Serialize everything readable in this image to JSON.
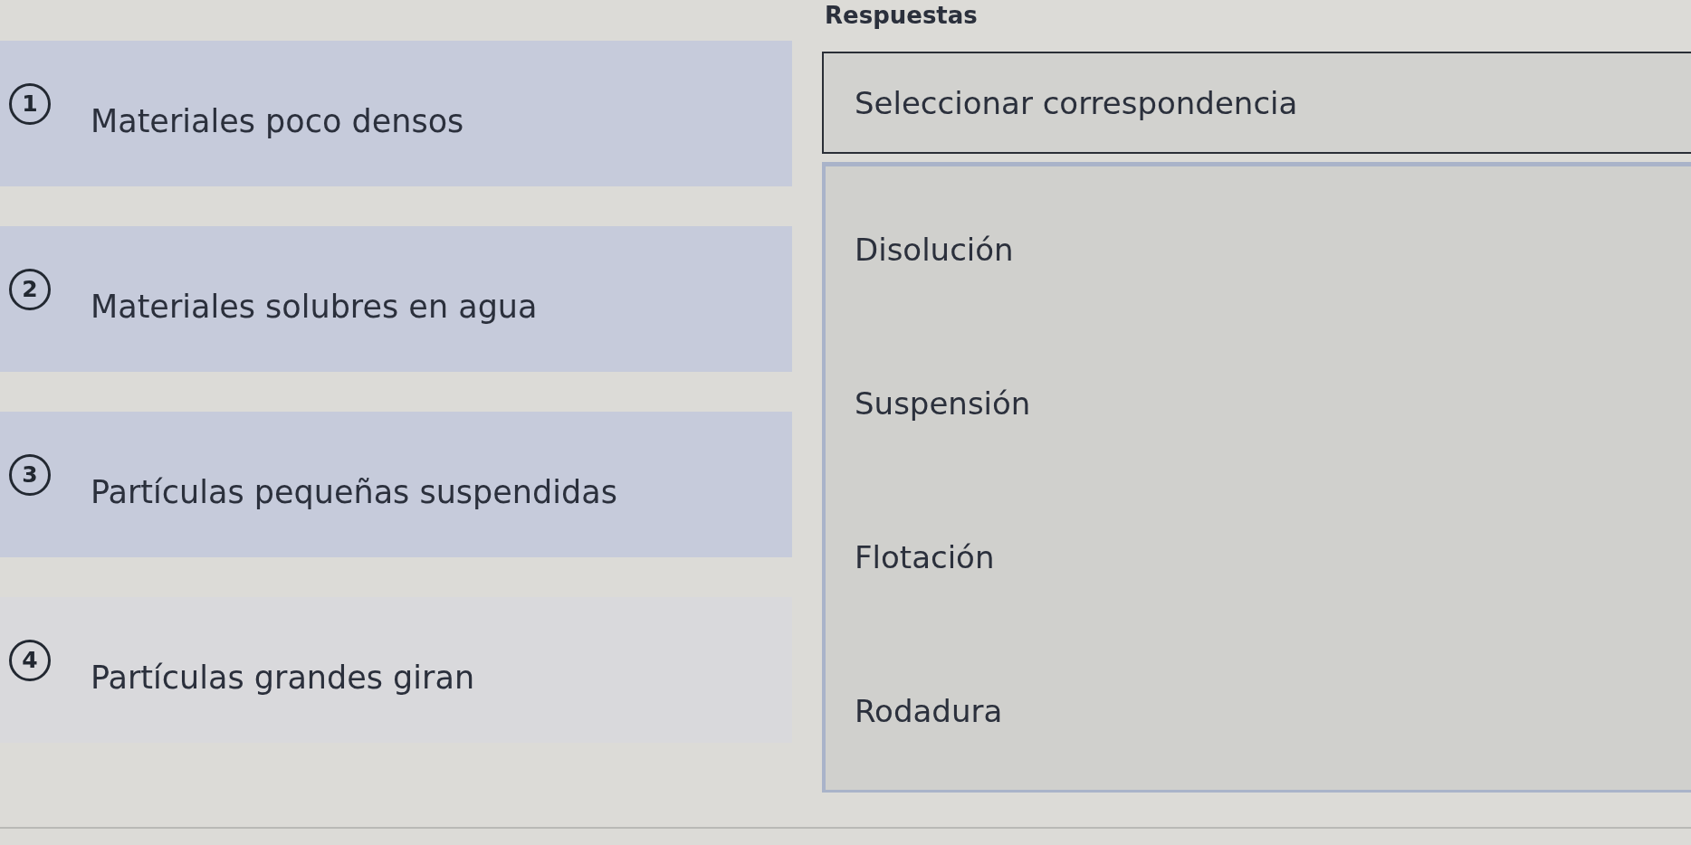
{
  "answers_heading": "Respuestas",
  "questions": [
    {
      "number": "1",
      "text": "Materiales poco densos",
      "highlighted": true
    },
    {
      "number": "2",
      "text": "Materiales solubres en agua",
      "highlighted": true
    },
    {
      "number": "3",
      "text": "Partículas pequeñas suspendidas",
      "highlighted": true
    },
    {
      "number": "4",
      "text": "Partículas grandes giran",
      "highlighted": false
    }
  ],
  "dropdown": {
    "label": "Seleccionar correspondencia"
  },
  "options": [
    {
      "label": "Disolución"
    },
    {
      "label": "Suspensión"
    },
    {
      "label": "Flotación"
    },
    {
      "label": "Rodadura"
    }
  ]
}
